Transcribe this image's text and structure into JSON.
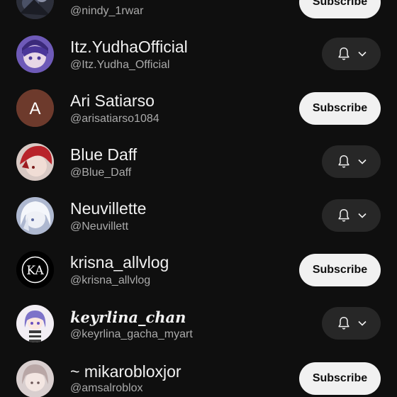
{
  "channels": [
    {
      "name": "",
      "handle": "@nindy_1rwar",
      "action": "Subscribe",
      "avatar_icon": "dark-illustration-avatar"
    },
    {
      "name": "Itz.YudhaOfficial",
      "handle": "@Itz.Yudha_Official",
      "action": "bell",
      "avatar_icon": "purple-anime-avatar"
    },
    {
      "name": "Ari Satiarso",
      "handle": "@arisatiarso1084",
      "action": "Subscribe",
      "avatar_letter": "A",
      "avatar_color": "#6d3a2c"
    },
    {
      "name": "Blue Daff",
      "handle": "@Blue_Daff",
      "action": "bell",
      "avatar_icon": "red-hair-anime-avatar"
    },
    {
      "name": "Neuvillette",
      "handle": "@Neuvillett",
      "action": "bell",
      "avatar_icon": "white-hair-anime-avatar"
    },
    {
      "name": "krisna_allvlog",
      "handle": "@krisna_allvlog",
      "action": "Subscribe",
      "avatar_icon": "ka-logo-avatar",
      "avatar_logo_text": "KA"
    },
    {
      "name": "keyrlina_chan",
      "handle": "@keyrlina_gacha_myart",
      "action": "bell",
      "avatar_icon": "gacha-character-avatar"
    },
    {
      "name": "~ mikarobloxjor",
      "handle": "@amsalroblox",
      "action": "Subscribe",
      "avatar_icon": "pale-anime-avatar"
    }
  ],
  "colors": {
    "background": "#0f0f0f",
    "subscribe_bg": "#f1f1f1",
    "bell_bg": "#272727",
    "name_text": "#f1f1f1",
    "handle_text": "#aaaaaa"
  }
}
